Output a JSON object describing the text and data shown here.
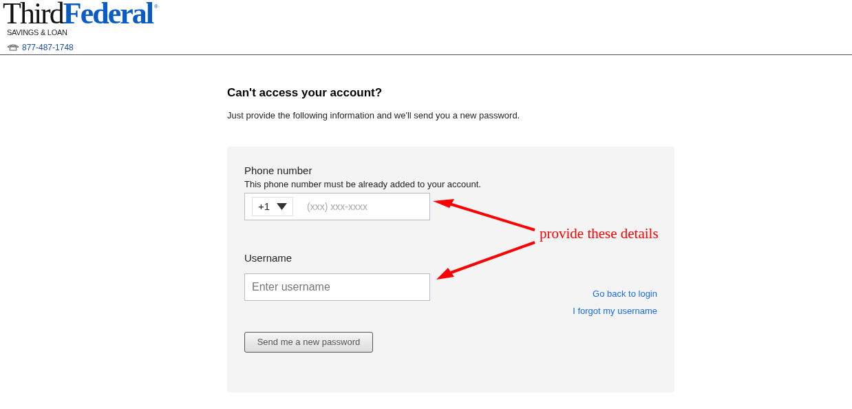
{
  "header": {
    "logo": {
      "first": "Third",
      "second": "Federal",
      "mark": "®",
      "tagline": "SAVINGS & LOAN"
    },
    "phone": "877-487-1748"
  },
  "title": "Can't access your account?",
  "subtitle": "Just provide the following information and we'll send you a new password.",
  "form": {
    "phone_label": "Phone number",
    "phone_hint": "This phone number must be already added to your account.",
    "country_code": "+1",
    "phone_placeholder": "(xxx) xxx-xxxx",
    "username_label": "Username",
    "username_placeholder": "Enter username",
    "submit": "Send me a new password",
    "submit_disabled": true,
    "links": [
      "Go back to login",
      "I forgot my username"
    ]
  },
  "annotation": "provide these details"
}
